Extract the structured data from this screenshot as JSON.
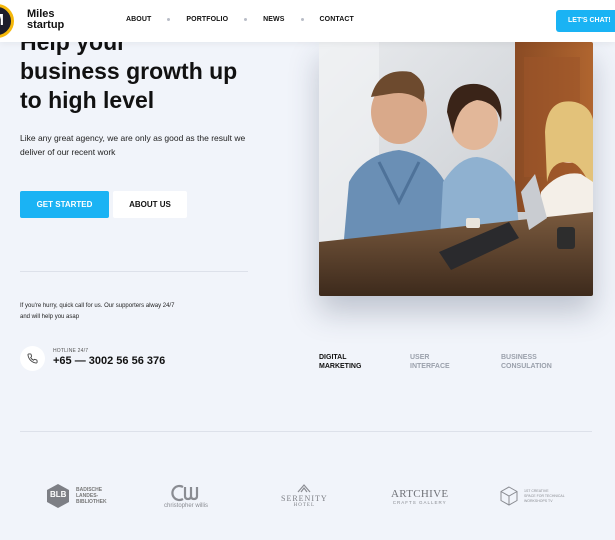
{
  "header": {
    "logo_mark": "M",
    "logo_line1": "Miles",
    "logo_line2": "startup",
    "nav": [
      "ABOUT",
      "PORTFOLIO",
      "NEWS",
      "CONTACT"
    ],
    "cta": "LET'S CHAT!"
  },
  "hero": {
    "title_line1": "Help your",
    "title_line2": "business growth up",
    "title_line3": "to high level",
    "desc": "Like any great agency, we are only as good as the result we deliver of our recent work",
    "primary_button": "GET STARTED",
    "secondary_button": "ABOUT US"
  },
  "contact": {
    "note_line1": "If you're hurry, quick call for us. Our supporters alway 24/7",
    "note_line2": "and will help you asap",
    "hotline_label": "HOTLINE 24/7",
    "hotline_number": "+65 — 3002 56 56 376"
  },
  "tabs": [
    {
      "line1": "DIGITAL",
      "line2": "MARKETING",
      "active": true
    },
    {
      "line1": "USER",
      "line2": "INTERFACE",
      "active": false
    },
    {
      "line1": "BUSINESS",
      "line2": "CONSULATION",
      "active": false
    }
  ],
  "partners": {
    "blb": {
      "mark": "BLB",
      "line1": "BADISCHE",
      "line2": "LANDES-",
      "line3": "BIBLIOTHEK"
    },
    "cw": {
      "name": "christopher willis"
    },
    "serenity": {
      "line1": "SERENITY",
      "line2": "HOTEL"
    },
    "artchive": {
      "line1": "ARTCHIVE",
      "line2": "CRAFTS GALLERY"
    },
    "creative": {
      "line1": "1ST CREATIVE",
      "line2": "SPACE FOR TECHNICAL",
      "line3": "WORKSHOPS TV"
    }
  },
  "colors": {
    "accent": "#1ab3f4",
    "background": "#f1f4fa",
    "text": "#111111",
    "muted": "#9aa0ab"
  }
}
